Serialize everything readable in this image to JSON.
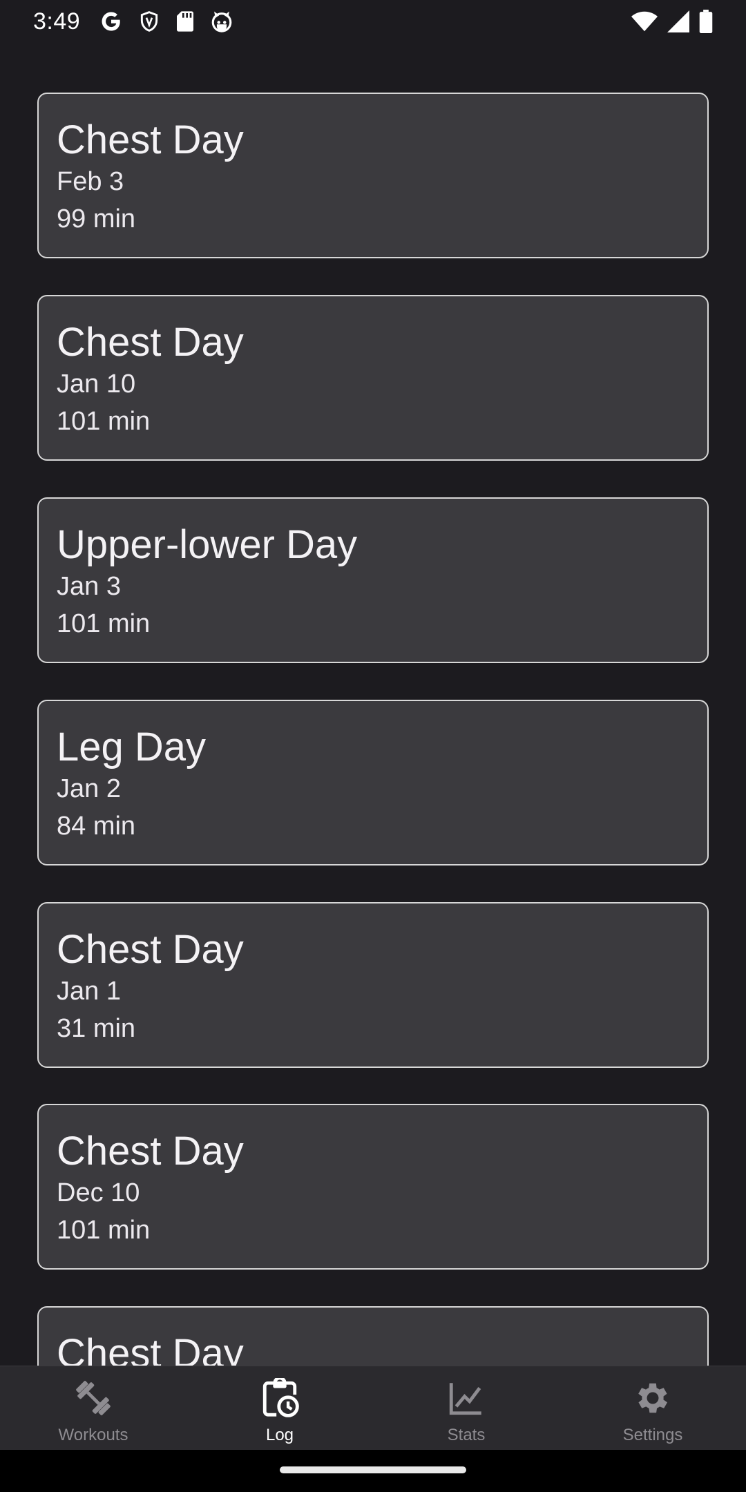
{
  "status_bar": {
    "time": "3:49",
    "left_icons": [
      "google-icon",
      "shield-icon",
      "sd-card-icon",
      "cat-icon"
    ],
    "right_icons": [
      "wifi-icon",
      "signal-icon",
      "battery-icon"
    ]
  },
  "workouts": [
    {
      "name": "Chest Day",
      "date": "Feb 3",
      "duration": "99 min"
    },
    {
      "name": "Chest Day",
      "date": "Jan 10",
      "duration": "101 min"
    },
    {
      "name": "Upper-lower Day",
      "date": "Jan 3",
      "duration": "101 min"
    },
    {
      "name": "Leg Day",
      "date": "Jan 2",
      "duration": "84 min"
    },
    {
      "name": "Chest Day",
      "date": "Jan 1",
      "duration": "31 min"
    },
    {
      "name": "Chest Day",
      "date": "Dec 10",
      "duration": "101 min"
    },
    {
      "name": "Chest Day",
      "date": "",
      "duration": ""
    }
  ],
  "bottom_nav": {
    "items": [
      {
        "label": "Workouts",
        "icon": "dumbbell-icon",
        "active": false
      },
      {
        "label": "Log",
        "icon": "clipboard-clock-icon",
        "active": true
      },
      {
        "label": "Stats",
        "icon": "line-chart-icon",
        "active": false
      },
      {
        "label": "Settings",
        "icon": "gear-icon",
        "active": false
      }
    ]
  },
  "colors": {
    "background": "#1c1b1f",
    "card": "#3b3a3e",
    "card_border": "#d7d7d7",
    "nav_background": "#2b2a2e",
    "nav_inactive": "#8e8c91",
    "nav_active": "#ffffff"
  }
}
